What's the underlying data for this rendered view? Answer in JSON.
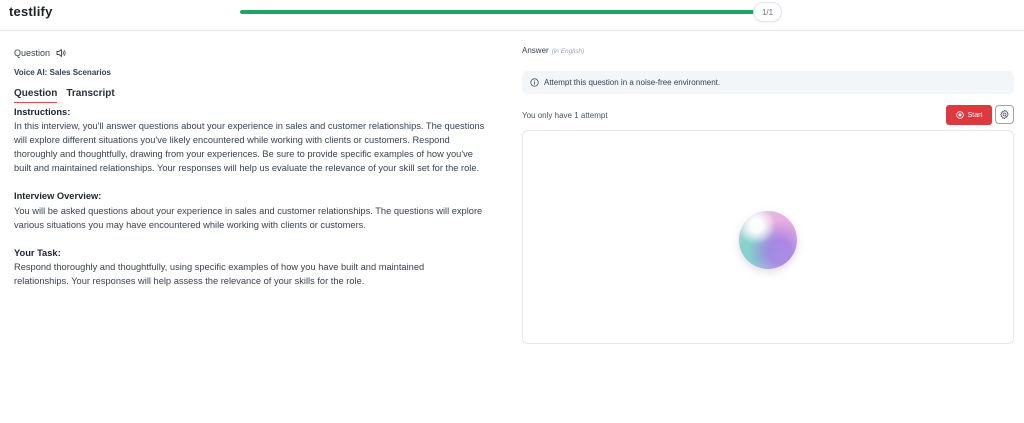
{
  "app": {
    "brand": "testlify"
  },
  "progress": {
    "label": "1/1",
    "fraction": 1.0
  },
  "question": {
    "heading": "Question",
    "title": "Voice AI: Sales Scenarios",
    "tabs": [
      {
        "label": "Question",
        "active": true
      },
      {
        "label": "Transcript",
        "active": false
      }
    ],
    "sections": [
      {
        "heading": "Instructions:",
        "lines": [
          "In this interview, you'll answer questions about your experience in sales and customer relationships. The questions",
          "will explore different situations you've likely encountered while working with clients or customers. Respond",
          "thoroughly and thoughtfully, drawing from your experiences. Be sure to provide specific examples of how you've",
          "built and maintained relationships. Your responses will help us evaluate the relevance of your skill set for the role."
        ]
      },
      {
        "heading": "Interview Overview:",
        "lines": [
          "You will be asked questions about your experience in sales and customer relationships. The questions will explore",
          "various situations you may have encountered while working with clients or customers."
        ]
      },
      {
        "heading": "Your Task:",
        "lines": [
          "Respond thoroughly and thoughtfully, using specific examples of how you have built and maintained",
          "relationships. Your responses will help assess the relevance of your skills for the role."
        ]
      }
    ]
  },
  "answer": {
    "heading": "Answer",
    "language_note": "(in English)",
    "notice": "Attempt this question in a noise-free environment.",
    "attempts_text": "You only have 1 attempt",
    "start_label": "Start"
  },
  "colors": {
    "accent_green": "#1fa463",
    "start_red": "#dc3a3f",
    "tab_underline": "#e5484d"
  },
  "icons": [
    "speaker-icon",
    "info-icon",
    "record-icon",
    "gear-icon",
    "voice-orb"
  ]
}
